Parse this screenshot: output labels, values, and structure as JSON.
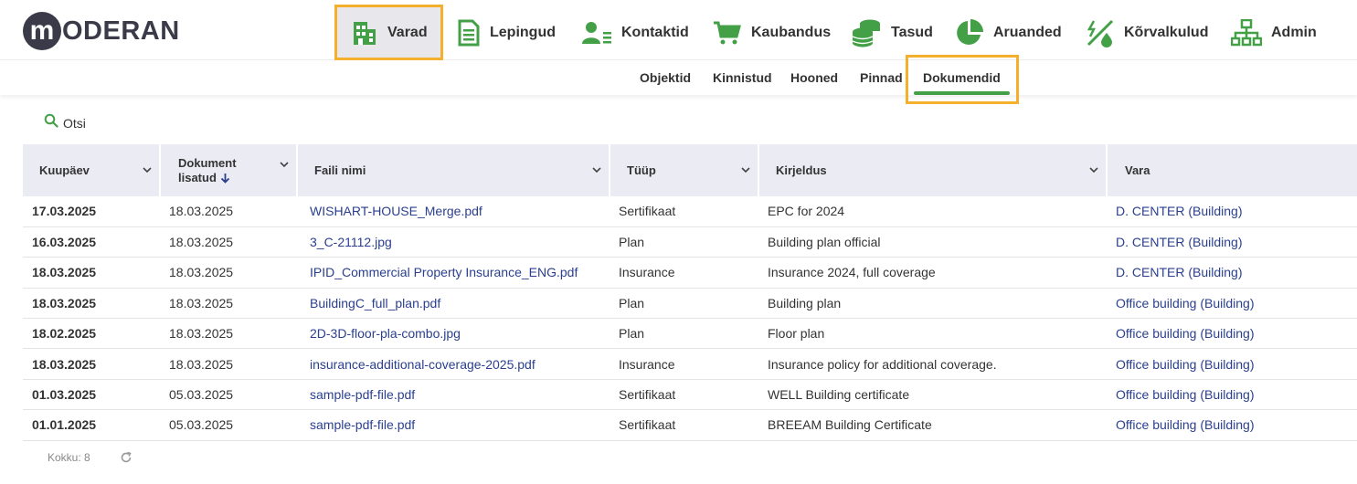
{
  "logo": {
    "letter": "m",
    "text": "ODERAN"
  },
  "nav": [
    {
      "label": "Varad",
      "icon": "building-icon",
      "active": true
    },
    {
      "label": "Lepingud",
      "icon": "document-icon"
    },
    {
      "label": "Kontaktid",
      "icon": "contacts-icon"
    },
    {
      "label": "Kaubandus",
      "icon": "cart-icon"
    },
    {
      "label": "Tasud",
      "icon": "coins-icon"
    },
    {
      "label": "Aruanded",
      "icon": "pie-chart-icon"
    },
    {
      "label": "Kõrvalkulud",
      "icon": "utilities-icon"
    },
    {
      "label": "Admin",
      "icon": "org-chart-icon"
    }
  ],
  "subnav": [
    {
      "label": "Objektid"
    },
    {
      "label": "Kinnistud"
    },
    {
      "label": "Hooned"
    },
    {
      "label": "Pinnad"
    },
    {
      "label": "Dokumendid",
      "active": true
    }
  ],
  "search": {
    "label": "Otsi",
    "icon": "search-icon"
  },
  "table": {
    "columns": [
      "Kuupäev",
      "Dokument lisatud",
      "Faili nimi",
      "Tüüp",
      "Kirjeldus",
      "Vara"
    ],
    "sort_column": "Dokument lisatud",
    "sort_direction": "descending",
    "rows": [
      [
        "17.03.2025",
        "18.03.2025",
        "WISHART-HOUSE_Merge.pdf",
        "Sertifikaat",
        "EPC for 2024",
        "D. CENTER (Building)"
      ],
      [
        "16.03.2025",
        "18.03.2025",
        "3_C-21112.jpg",
        "Plan",
        "Building plan official",
        "D. CENTER (Building)"
      ],
      [
        "18.03.2025",
        "18.03.2025",
        "IPID_Commercial Property Insurance_ENG.pdf",
        "Insurance",
        "Insurance 2024, full coverage",
        "D. CENTER (Building)"
      ],
      [
        "18.03.2025",
        "18.03.2025",
        "BuildingC_full_plan.pdf",
        "Plan",
        "Building plan",
        "Office building (Building)"
      ],
      [
        "18.02.2025",
        "18.03.2025",
        "2D-3D-floor-pla-combo.jpg",
        "Plan",
        "Floor plan",
        "Office building (Building)"
      ],
      [
        "18.03.2025",
        "18.03.2025",
        "insurance-additional-coverage-2025.pdf",
        "Insurance",
        "Insurance policy for additional coverage.",
        "Office building (Building)"
      ],
      [
        "01.03.2025",
        "05.03.2025",
        "sample-pdf-file.pdf",
        "Sertifikaat",
        "WELL Building certificate",
        "Office building (Building)"
      ],
      [
        "01.01.2025",
        "05.03.2025",
        "sample-pdf-file.pdf",
        "Sertifikaat",
        "BREEAM Building Certificate",
        "Office building (Building)"
      ]
    ]
  },
  "footer": {
    "total_label": "Kokku: 8",
    "refresh_icon": "refresh-icon"
  },
  "colors": {
    "accent_green": "#43a047",
    "highlight_orange": "#f4b02d",
    "link_blue": "#2a3f8f",
    "logo_dark": "#3b3a48",
    "header_bg": "#ebebf4"
  }
}
